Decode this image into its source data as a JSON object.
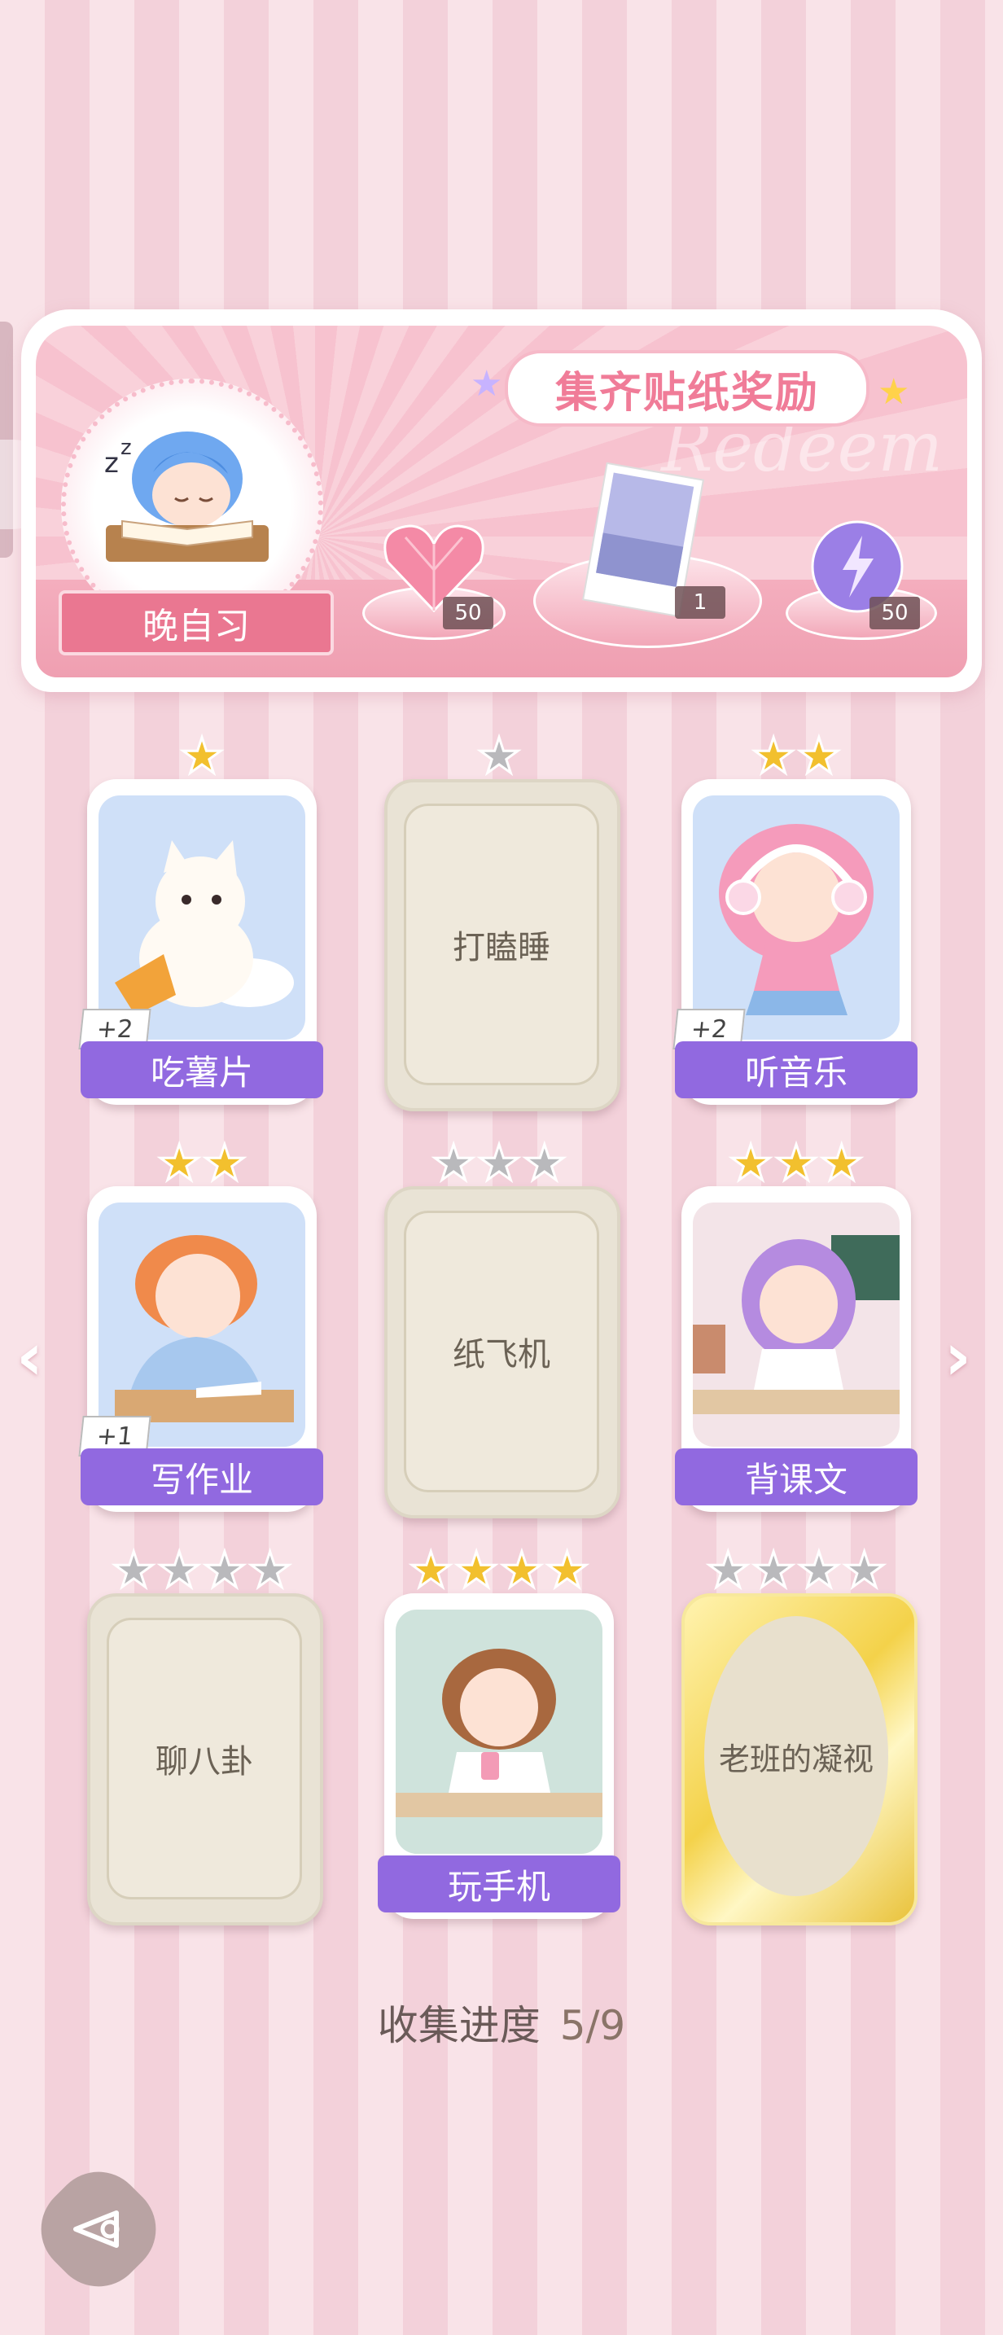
{
  "banner": {
    "title": "集齐贴纸奖励",
    "watermark": "Redeem",
    "activity": "晚自习",
    "rewards": [
      {
        "name": "heart-gem",
        "count": "50"
      },
      {
        "name": "photo-card",
        "count": "1"
      },
      {
        "name": "lightning-orb",
        "count": "50"
      }
    ]
  },
  "cards": [
    {
      "label": "吃薯片",
      "stars_total": 1,
      "stars_filled": 1,
      "state": "unlocked",
      "bonus": "+2"
    },
    {
      "label": "打瞌睡",
      "stars_total": 1,
      "stars_filled": 0,
      "state": "locked"
    },
    {
      "label": "听音乐",
      "stars_total": 2,
      "stars_filled": 2,
      "state": "unlocked",
      "bonus": "+2"
    },
    {
      "label": "写作业",
      "stars_total": 2,
      "stars_filled": 2,
      "state": "unlocked",
      "bonus": "+1"
    },
    {
      "label": "纸飞机",
      "stars_total": 3,
      "stars_filled": 0,
      "state": "locked"
    },
    {
      "label": "背课文",
      "stars_total": 3,
      "stars_filled": 3,
      "state": "unlocked"
    },
    {
      "label": "聊八卦",
      "stars_total": 4,
      "stars_filled": 0,
      "state": "locked"
    },
    {
      "label": "玩手机",
      "stars_total": 4,
      "stars_filled": 4,
      "state": "unlocked"
    },
    {
      "label": "老班的凝视",
      "stars_total": 4,
      "stars_filled": 0,
      "state": "gold-locked"
    }
  ],
  "progress": {
    "label": "收集进度",
    "value": "5/9"
  },
  "icons": {
    "prev": "chevron-left-icon",
    "next": "chevron-right-icon",
    "back": "back-icon"
  },
  "colors": {
    "label_purple": "#9169e0",
    "banner_pink": "#ea7791",
    "star_gold": "#f2c02e",
    "star_gray": "#b9b9bc"
  }
}
